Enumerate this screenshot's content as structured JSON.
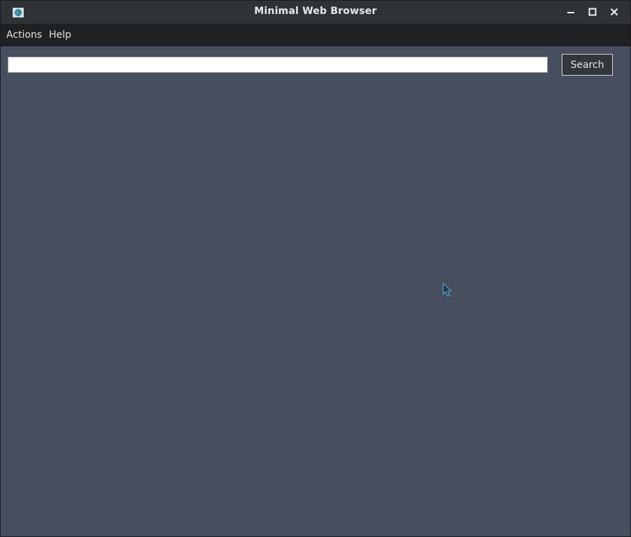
{
  "window": {
    "title": "Minimal Web Browser",
    "controls": [
      "minimize",
      "maximize",
      "close"
    ]
  },
  "menubar": {
    "items": [
      {
        "label": "Actions"
      },
      {
        "label": "Help"
      }
    ]
  },
  "search": {
    "value": "",
    "placeholder": "",
    "button_label": "Search"
  },
  "colors": {
    "titlebar": "#2f3338",
    "menubar": "#1f2123",
    "content_background": "#474e5d",
    "text": "#e2e2e2"
  },
  "icons": {
    "app": "globe-icon",
    "minimize": "minimize-icon",
    "maximize": "maximize-icon",
    "close": "close-icon"
  }
}
